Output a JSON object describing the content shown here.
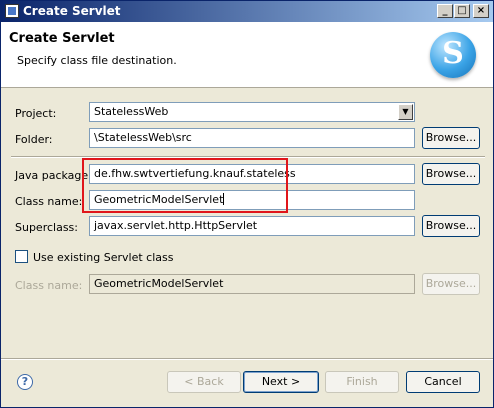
{
  "window": {
    "title": "Create Servlet",
    "minimize": "_",
    "maximize": "□",
    "close": "×"
  },
  "banner": {
    "title": "Create Servlet",
    "description": "Specify class file destination.",
    "logo_letter": "S"
  },
  "form": {
    "project": {
      "label": "Project:",
      "value": "StatelessWeb"
    },
    "folder": {
      "label": "Folder:",
      "value": "\\StatelessWeb\\src",
      "browse": "Browse..."
    },
    "java_package": {
      "label": "Java package:",
      "value": "de.fhw.swtvertiefung.knauf.stateless",
      "browse": "Browse..."
    },
    "class_name": {
      "label": "Class name:",
      "value": "GeometricModelServlet"
    },
    "superclass": {
      "label": "Superclass:",
      "value": "javax.servlet.http.HttpServlet",
      "browse": "Browse..."
    },
    "use_existing": {
      "label": "Use existing Servlet class",
      "checked": false
    },
    "existing_class_name": {
      "label": "Class name:",
      "value": "GeometricModelServlet",
      "browse": "Browse..."
    }
  },
  "buttons": {
    "help": "?",
    "back": "< Back",
    "next": "Next >",
    "finish": "Finish",
    "cancel": "Cancel"
  },
  "icons": {
    "combo": "chevron-down-icon",
    "help": "help-icon",
    "window": "window-icon"
  },
  "colors": {
    "highlight": "#e0161b",
    "titlebar": "#0a246a"
  }
}
